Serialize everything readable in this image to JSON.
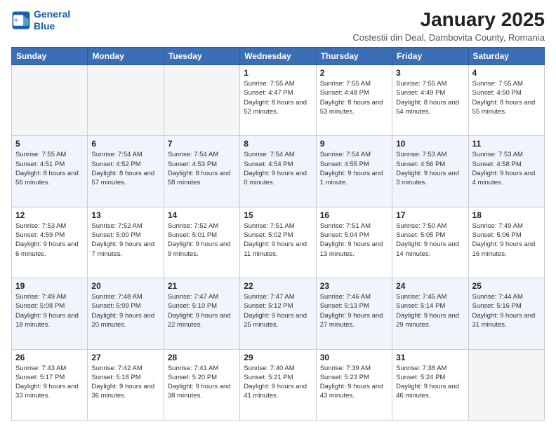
{
  "logo": {
    "line1": "General",
    "line2": "Blue"
  },
  "title": "January 2025",
  "subtitle": "Costestii din Deal, Dambovita County, Romania",
  "weekdays": [
    "Sunday",
    "Monday",
    "Tuesday",
    "Wednesday",
    "Thursday",
    "Friday",
    "Saturday"
  ],
  "weeks": [
    [
      {
        "day": "",
        "sunrise": "",
        "sunset": "",
        "daylight": ""
      },
      {
        "day": "",
        "sunrise": "",
        "sunset": "",
        "daylight": ""
      },
      {
        "day": "",
        "sunrise": "",
        "sunset": "",
        "daylight": ""
      },
      {
        "day": "1",
        "sunrise": "Sunrise: 7:55 AM",
        "sunset": "Sunset: 4:47 PM",
        "daylight": "Daylight: 8 hours and 52 minutes."
      },
      {
        "day": "2",
        "sunrise": "Sunrise: 7:55 AM",
        "sunset": "Sunset: 4:48 PM",
        "daylight": "Daylight: 8 hours and 53 minutes."
      },
      {
        "day": "3",
        "sunrise": "Sunrise: 7:55 AM",
        "sunset": "Sunset: 4:49 PM",
        "daylight": "Daylight: 8 hours and 54 minutes."
      },
      {
        "day": "4",
        "sunrise": "Sunrise: 7:55 AM",
        "sunset": "Sunset: 4:50 PM",
        "daylight": "Daylight: 8 hours and 55 minutes."
      }
    ],
    [
      {
        "day": "5",
        "sunrise": "Sunrise: 7:55 AM",
        "sunset": "Sunset: 4:51 PM",
        "daylight": "Daylight: 8 hours and 56 minutes."
      },
      {
        "day": "6",
        "sunrise": "Sunrise: 7:54 AM",
        "sunset": "Sunset: 4:52 PM",
        "daylight": "Daylight: 8 hours and 57 minutes."
      },
      {
        "day": "7",
        "sunrise": "Sunrise: 7:54 AM",
        "sunset": "Sunset: 4:53 PM",
        "daylight": "Daylight: 8 hours and 58 minutes."
      },
      {
        "day": "8",
        "sunrise": "Sunrise: 7:54 AM",
        "sunset": "Sunset: 4:54 PM",
        "daylight": "Daylight: 9 hours and 0 minutes."
      },
      {
        "day": "9",
        "sunrise": "Sunrise: 7:54 AM",
        "sunset": "Sunset: 4:55 PM",
        "daylight": "Daylight: 9 hours and 1 minute."
      },
      {
        "day": "10",
        "sunrise": "Sunrise: 7:53 AM",
        "sunset": "Sunset: 4:56 PM",
        "daylight": "Daylight: 9 hours and 3 minutes."
      },
      {
        "day": "11",
        "sunrise": "Sunrise: 7:53 AM",
        "sunset": "Sunset: 4:58 PM",
        "daylight": "Daylight: 9 hours and 4 minutes."
      }
    ],
    [
      {
        "day": "12",
        "sunrise": "Sunrise: 7:53 AM",
        "sunset": "Sunset: 4:59 PM",
        "daylight": "Daylight: 9 hours and 6 minutes."
      },
      {
        "day": "13",
        "sunrise": "Sunrise: 7:52 AM",
        "sunset": "Sunset: 5:00 PM",
        "daylight": "Daylight: 9 hours and 7 minutes."
      },
      {
        "day": "14",
        "sunrise": "Sunrise: 7:52 AM",
        "sunset": "Sunset: 5:01 PM",
        "daylight": "Daylight: 9 hours and 9 minutes."
      },
      {
        "day": "15",
        "sunrise": "Sunrise: 7:51 AM",
        "sunset": "Sunset: 5:02 PM",
        "daylight": "Daylight: 9 hours and 11 minutes."
      },
      {
        "day": "16",
        "sunrise": "Sunrise: 7:51 AM",
        "sunset": "Sunset: 5:04 PM",
        "daylight": "Daylight: 9 hours and 13 minutes."
      },
      {
        "day": "17",
        "sunrise": "Sunrise: 7:50 AM",
        "sunset": "Sunset: 5:05 PM",
        "daylight": "Daylight: 9 hours and 14 minutes."
      },
      {
        "day": "18",
        "sunrise": "Sunrise: 7:49 AM",
        "sunset": "Sunset: 5:06 PM",
        "daylight": "Daylight: 9 hours and 16 minutes."
      }
    ],
    [
      {
        "day": "19",
        "sunrise": "Sunrise: 7:49 AM",
        "sunset": "Sunset: 5:08 PM",
        "daylight": "Daylight: 9 hours and 18 minutes."
      },
      {
        "day": "20",
        "sunrise": "Sunrise: 7:48 AM",
        "sunset": "Sunset: 5:09 PM",
        "daylight": "Daylight: 9 hours and 20 minutes."
      },
      {
        "day": "21",
        "sunrise": "Sunrise: 7:47 AM",
        "sunset": "Sunset: 5:10 PM",
        "daylight": "Daylight: 9 hours and 22 minutes."
      },
      {
        "day": "22",
        "sunrise": "Sunrise: 7:47 AM",
        "sunset": "Sunset: 5:12 PM",
        "daylight": "Daylight: 9 hours and 25 minutes."
      },
      {
        "day": "23",
        "sunrise": "Sunrise: 7:46 AM",
        "sunset": "Sunset: 5:13 PM",
        "daylight": "Daylight: 9 hours and 27 minutes."
      },
      {
        "day": "24",
        "sunrise": "Sunrise: 7:45 AM",
        "sunset": "Sunset: 5:14 PM",
        "daylight": "Daylight: 9 hours and 29 minutes."
      },
      {
        "day": "25",
        "sunrise": "Sunrise: 7:44 AM",
        "sunset": "Sunset: 5:16 PM",
        "daylight": "Daylight: 9 hours and 31 minutes."
      }
    ],
    [
      {
        "day": "26",
        "sunrise": "Sunrise: 7:43 AM",
        "sunset": "Sunset: 5:17 PM",
        "daylight": "Daylight: 9 hours and 33 minutes."
      },
      {
        "day": "27",
        "sunrise": "Sunrise: 7:42 AM",
        "sunset": "Sunset: 5:18 PM",
        "daylight": "Daylight: 9 hours and 36 minutes."
      },
      {
        "day": "28",
        "sunrise": "Sunrise: 7:41 AM",
        "sunset": "Sunset: 5:20 PM",
        "daylight": "Daylight: 9 hours and 38 minutes."
      },
      {
        "day": "29",
        "sunrise": "Sunrise: 7:40 AM",
        "sunset": "Sunset: 5:21 PM",
        "daylight": "Daylight: 9 hours and 41 minutes."
      },
      {
        "day": "30",
        "sunrise": "Sunrise: 7:39 AM",
        "sunset": "Sunset: 5:23 PM",
        "daylight": "Daylight: 9 hours and 43 minutes."
      },
      {
        "day": "31",
        "sunrise": "Sunrise: 7:38 AM",
        "sunset": "Sunset: 5:24 PM",
        "daylight": "Daylight: 9 hours and 46 minutes."
      },
      {
        "day": "",
        "sunrise": "",
        "sunset": "",
        "daylight": ""
      }
    ]
  ]
}
